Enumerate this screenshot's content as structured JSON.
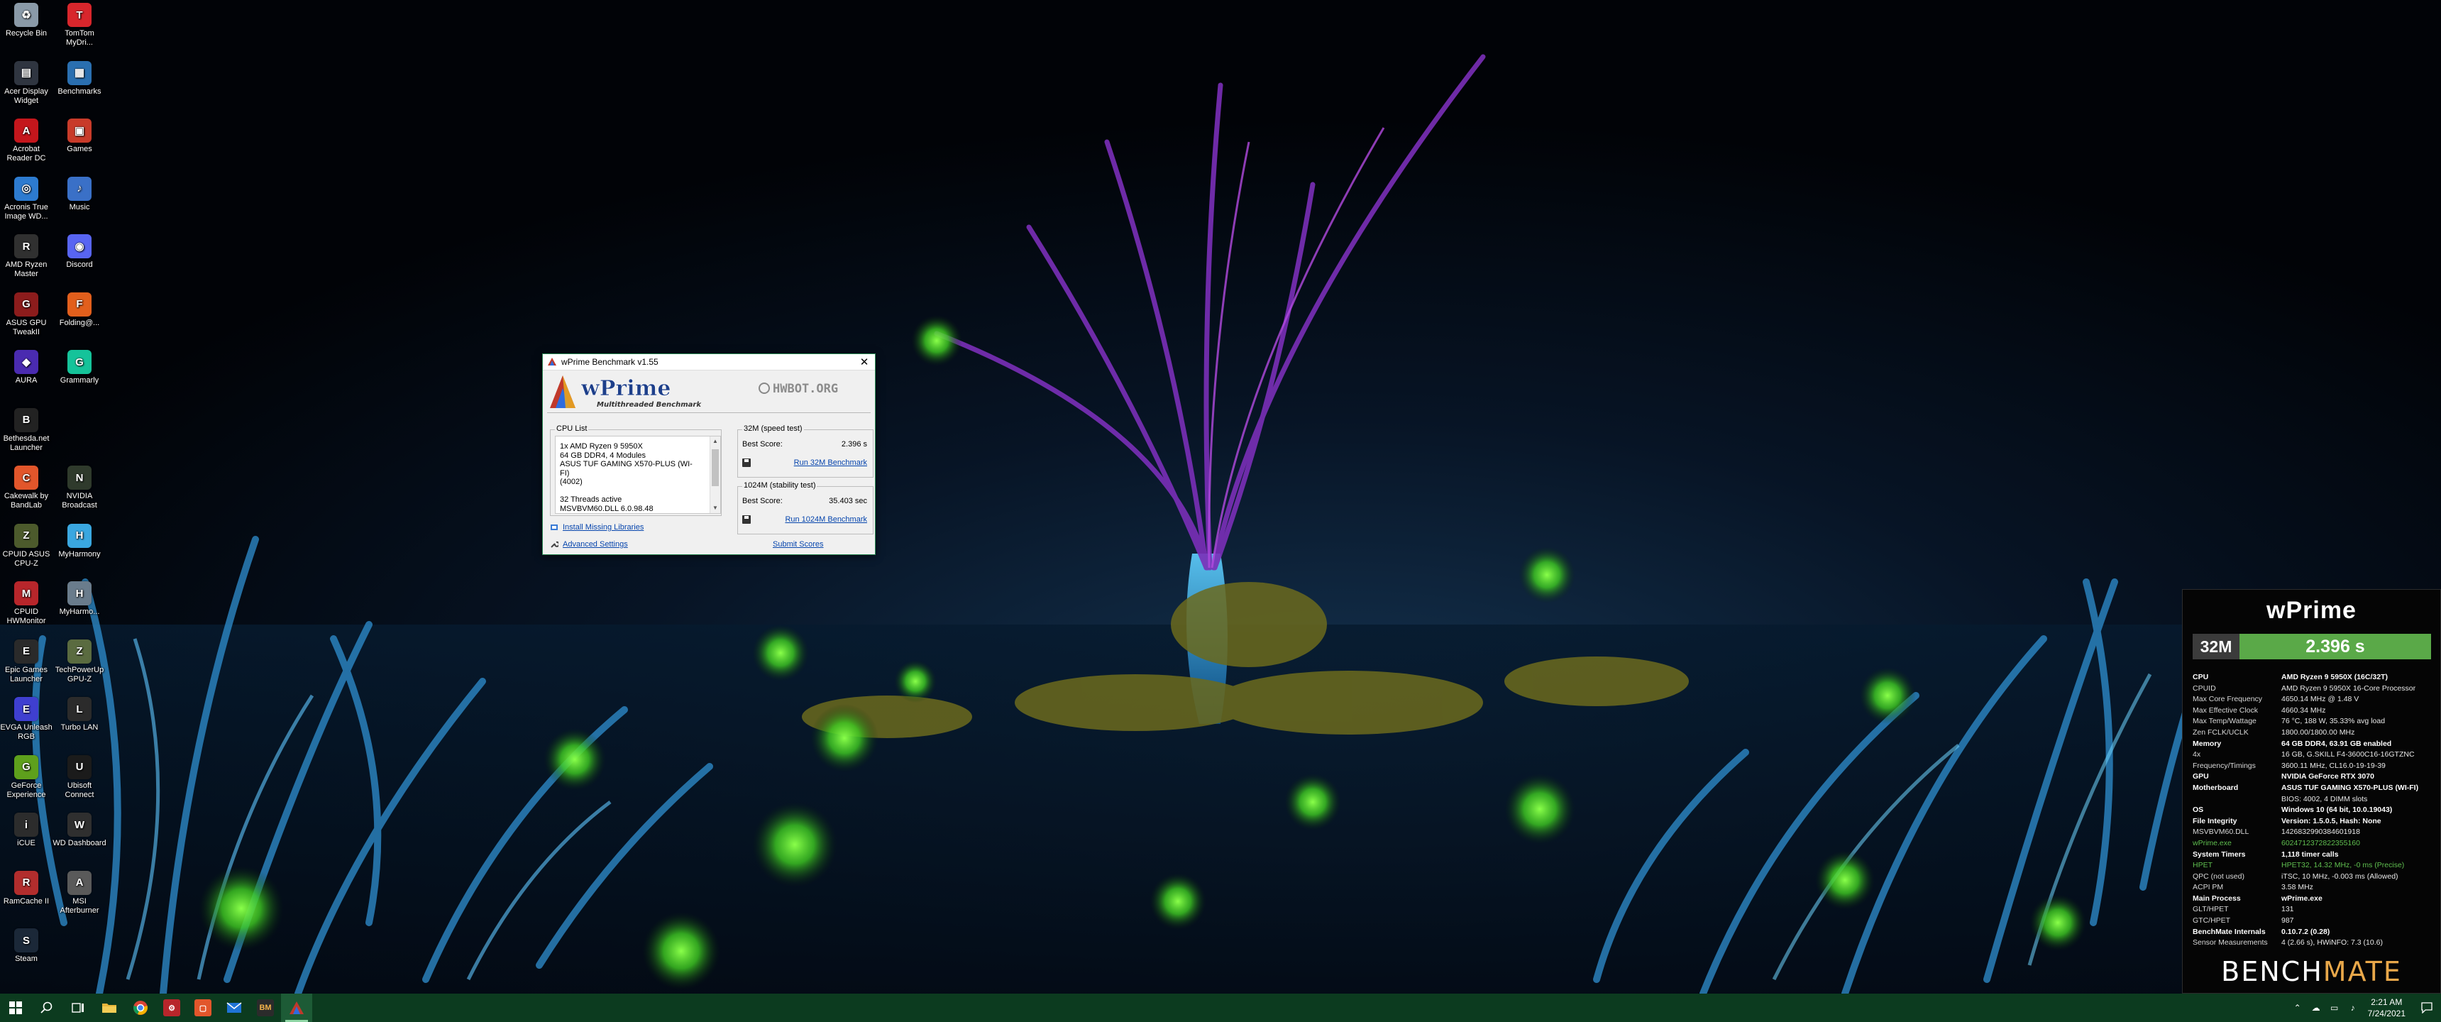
{
  "desktop_icons": [
    {
      "label": "Recycle Bin",
      "icon": "recycle-bin-icon",
      "color": "#8a9aa8",
      "glyph": "♻"
    },
    {
      "label": "TomTom MyDri...",
      "icon": "tomtom-icon",
      "color": "#d8262c",
      "glyph": "T"
    },
    {
      "label": "Acer Display Widget",
      "icon": "acer-display-widget-icon",
      "color": "#2f3540",
      "glyph": "▤"
    },
    {
      "label": "Benchmarks",
      "icon": "folder-icon",
      "color": "#2a6fb0",
      "glyph": "▦"
    },
    {
      "label": "Acrobat Reader DC",
      "icon": "acrobat-icon",
      "color": "#c4161c",
      "glyph": "A"
    },
    {
      "label": "Games",
      "icon": "games-folder-icon",
      "color": "#c83b2a",
      "glyph": "▣"
    },
    {
      "label": "Acronis True Image WD...",
      "icon": "acronis-icon",
      "color": "#2d7bd0",
      "glyph": "◎"
    },
    {
      "label": "Music",
      "icon": "music-folder-icon",
      "color": "#3a70c7",
      "glyph": "♪"
    },
    {
      "label": "AMD Ryzen Master",
      "icon": "amd-ryzen-master-icon",
      "color": "#303030",
      "glyph": "R"
    },
    {
      "label": "Discord",
      "icon": "discord-icon",
      "color": "#5865f2",
      "glyph": "◉"
    },
    {
      "label": "ASUS GPU TweakII",
      "icon": "asus-gpu-tweak-icon",
      "color": "#8c1c1c",
      "glyph": "G"
    },
    {
      "label": "Folding@...",
      "icon": "folding-at-home-icon",
      "color": "#e25f1c",
      "glyph": "F"
    },
    {
      "label": "AURA",
      "icon": "aura-icon",
      "color": "#4a2bb0",
      "glyph": "◆"
    },
    {
      "label": "Grammarly",
      "icon": "grammarly-icon",
      "color": "#15c39a",
      "glyph": "G"
    },
    {
      "label": "Bethesda.net Launcher",
      "icon": "bethesda-icon",
      "color": "#222222",
      "glyph": "B"
    },
    {
      "label": "",
      "icon": "blank-icon",
      "color": "transparent",
      "glyph": ""
    },
    {
      "label": "Cakewalk by BandLab",
      "icon": "cakewalk-icon",
      "color": "#e2562b",
      "glyph": "C"
    },
    {
      "label": "NVIDIA Broadcast",
      "icon": "nvidia-broadcast-icon",
      "color": "#2f3a2c",
      "glyph": "N"
    },
    {
      "label": "CPUID ASUS CPU-Z",
      "icon": "cpuz-asus-icon",
      "color": "#4c5a2c",
      "glyph": "Z"
    },
    {
      "label": "MyHarmony",
      "icon": "myharmony-icon",
      "color": "#3aa7e0",
      "glyph": "H"
    },
    {
      "label": "CPUID HWMonitor",
      "icon": "hwmonitor-icon",
      "color": "#b8262b",
      "glyph": "M"
    },
    {
      "label": "MyHarmo...",
      "icon": "myharmony-shortcut-icon",
      "color": "#6a7c8c",
      "glyph": "H"
    },
    {
      "label": "Epic Games Launcher",
      "icon": "epic-games-icon",
      "color": "#2a2a2a",
      "glyph": "E"
    },
    {
      "label": "TechPowerUp GPU-Z",
      "icon": "gpuz-icon",
      "color": "#5a6b40",
      "glyph": "Z"
    },
    {
      "label": "EVGA Unleash RGB",
      "icon": "evga-icon",
      "color": "#3f3fd0",
      "glyph": "E"
    },
    {
      "label": "Turbo LAN",
      "icon": "turbo-lan-icon",
      "color": "#2b2b2b",
      "glyph": "L"
    },
    {
      "label": "GeForce Experience",
      "icon": "geforce-icon",
      "color": "#5ea01c",
      "glyph": "G"
    },
    {
      "label": "Ubisoft Connect",
      "icon": "ubisoft-icon",
      "color": "#1b1b1b",
      "glyph": "U"
    },
    {
      "label": "iCUE",
      "icon": "icue-icon",
      "color": "#2c2c2c",
      "glyph": "i"
    },
    {
      "label": "WD Dashboard",
      "icon": "wd-dashboard-icon",
      "color": "#2f2f2f",
      "glyph": "W"
    },
    {
      "label": "RamCache II",
      "icon": "ramcache-icon",
      "color": "#b22d2d",
      "glyph": "R"
    },
    {
      "label": "MSI Afterburner",
      "icon": "msi-afterburner-icon",
      "color": "#5a5a5a",
      "glyph": "A"
    },
    {
      "label": "Steam",
      "icon": "steam-icon",
      "color": "#1b2838",
      "glyph": "S"
    }
  ],
  "wprime": {
    "window_title": "wPrime Benchmark v1.55",
    "close_label": "✕",
    "logo_text": "wPrime",
    "logo_subtitle": "Multithreaded Benchmark",
    "hwbot_text": "HWBOT.ORG",
    "cpu_list": {
      "legend": "CPU List",
      "lines": [
        "1x AMD Ryzen 9 5950X",
        "64 GB DDR4, 4 Modules",
        "ASUS TUF GAMING X570-PLUS (WI-FI)",
        "(4002)",
        "",
        "32 Threads active",
        "MSVBVM60.DLL 6.0.98.48"
      ]
    },
    "speed_test": {
      "legend": "32M (speed test)",
      "label": "Best Score:",
      "value": "2.396 s",
      "run_label": "Run 32M Benchmark"
    },
    "stability_test": {
      "legend": "1024M (stability test)",
      "label": "Best Score:",
      "value": "35.403 sec",
      "run_label": "Run 1024M Benchmark"
    },
    "install_libraries": "Install Missing Libraries",
    "advanced_settings": "Advanced Settings",
    "submit_scores": "Submit Scores"
  },
  "benchmate": {
    "title": "wPrime",
    "mode": "32M",
    "score": "2.396 s",
    "score_color": "#5aa948",
    "rows": [
      {
        "k": "CPU",
        "v": "AMD Ryzen 9 5950X (16C/32T)",
        "style": "bold"
      },
      {
        "k": "CPUID",
        "v": "AMD Ryzen 9 5950X 16-Core Processor",
        "style": ""
      },
      {
        "k": "Max Core Frequency",
        "v": "4650.14 MHz @ 1.48 V",
        "style": ""
      },
      {
        "k": "Max Effective Clock",
        "v": "4660.34 MHz",
        "style": ""
      },
      {
        "k": "Max Temp/Wattage",
        "v": "76 °C, 188 W, 35.33% avg load",
        "style": ""
      },
      {
        "k": "Zen FCLK/UCLK",
        "v": "1800.00/1800.00 MHz",
        "style": ""
      },
      {
        "k": "Memory",
        "v": "64 GB DDR4, 63.91 GB enabled",
        "style": "bold"
      },
      {
        "k": "4x",
        "v": "16 GB, G.SKILL F4-3600C16-16GTZNC",
        "style": ""
      },
      {
        "k": "Frequency/Timings",
        "v": "3600.11 MHz, CL16.0-19-19-39",
        "style": ""
      },
      {
        "k": "GPU",
        "v": "NVIDIA GeForce RTX 3070",
        "style": "bold"
      },
      {
        "k": "Motherboard",
        "v": "ASUS TUF GAMING X570-PLUS (WI-FI)",
        "style": "bold"
      },
      {
        "k": "",
        "v": "BIOS: 4002, 4 DIMM slots",
        "style": ""
      },
      {
        "k": "OS",
        "v": "Windows 10 (64 bit, 10.0.19043)",
        "style": "bold"
      },
      {
        "k": "File Integrity",
        "v": "Version: 1.5.0.5, Hash: None",
        "style": "bold"
      },
      {
        "k": "MSVBVM60.DLL",
        "v": "1426832990384601918",
        "style": ""
      },
      {
        "k": "wPrime.exe",
        "v": "6024712372822355160",
        "style": "green"
      },
      {
        "k": "System Timers",
        "v": "1,118 timer calls",
        "style": "bold"
      },
      {
        "k": "HPET",
        "v": "HPET32, 14.32 MHz, -0 ms (Precise)",
        "style": "green"
      },
      {
        "k": "QPC (not used)",
        "v": "iTSC, 10 MHz, -0.003 ms (Allowed)",
        "style": ""
      },
      {
        "k": "ACPI PM",
        "v": "3.58 MHz",
        "style": ""
      },
      {
        "k": "Main Process",
        "v": "wPrime.exe",
        "style": "bold"
      },
      {
        "k": "GLT/HPET",
        "v": "131",
        "style": ""
      },
      {
        "k": "GTC/HPET",
        "v": "987",
        "style": ""
      },
      {
        "k": "BenchMate Internals",
        "v": "0.10.7.2 (0.28)",
        "style": "bold"
      },
      {
        "k": "Sensor Measurements",
        "v": "4 (2.66 s), HWiNFO: 7.3 (10.6)",
        "style": ""
      }
    ],
    "logo_bench": "BENCH",
    "logo_mate": "MATE"
  },
  "taskbar": {
    "apps": [
      {
        "name": "start-button",
        "icon": "windows-logo-icon"
      },
      {
        "name": "search-button",
        "icon": "search-icon"
      },
      {
        "name": "task-view-button",
        "icon": "task-view-icon"
      },
      {
        "name": "file-explorer-button",
        "icon": "folder-icon"
      },
      {
        "name": "chrome-button",
        "icon": "chrome-icon"
      },
      {
        "name": "hwmonitor-taskbar-button",
        "icon": "hwmonitor-icon"
      },
      {
        "name": "office-taskbar-button",
        "icon": "office-icon"
      },
      {
        "name": "mail-taskbar-button",
        "icon": "mail-icon"
      },
      {
        "name": "benchmate-taskbar-button",
        "icon": "benchmate-icon"
      },
      {
        "name": "wprime-taskbar-button",
        "icon": "wprime-icon"
      }
    ],
    "benchmate_glyph": "BM",
    "time": "2:21 AM",
    "date": "7/24/2021",
    "taskbar_color": "#0c3b1f"
  }
}
